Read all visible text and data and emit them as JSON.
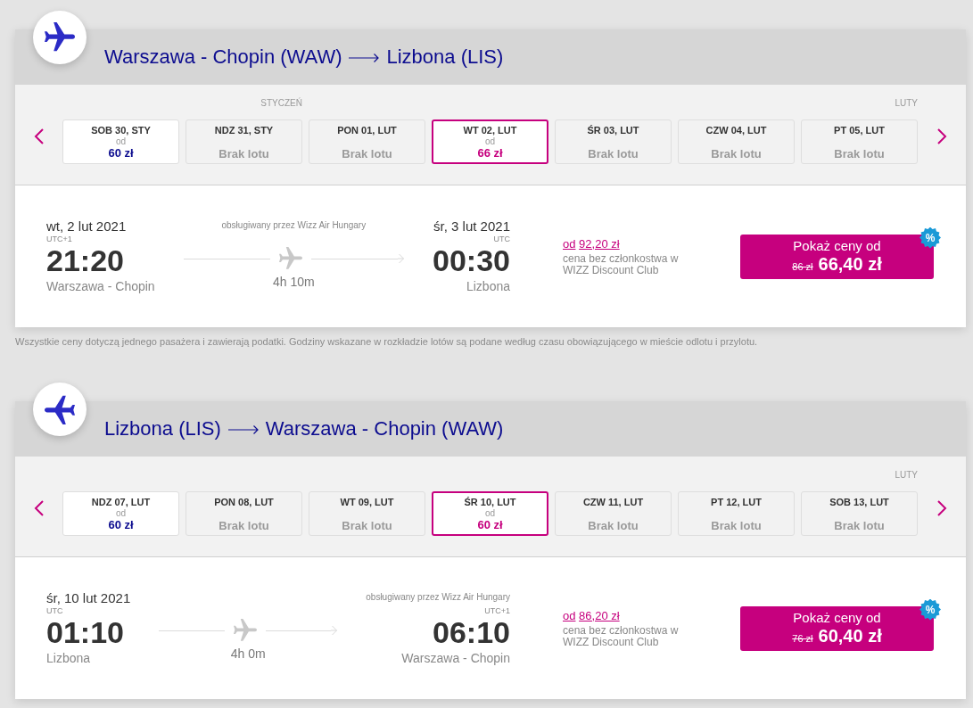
{
  "routes": [
    {
      "kind": "outbound",
      "origin": "Warszawa - Chopin (WAW)",
      "destination": "Lizbona (LIS)",
      "months": [
        {
          "label": "STYCZEŃ",
          "days": [
            {
              "label": "SOB 30, STY",
              "kind": "available",
              "from": "od",
              "price": "60 zł",
              "selected": false
            },
            {
              "label": "NDZ 31, STY",
              "kind": "unavailable",
              "status": "Brak lotu",
              "selected": false
            }
          ]
        },
        {
          "label": "LUTY",
          "days": [
            {
              "label": "PON 01, LUT",
              "kind": "unavailable",
              "status": "Brak lotu",
              "selected": false
            },
            {
              "label": "WT 02, LUT",
              "kind": "available",
              "from": "od",
              "price": "66 zł",
              "selected": true
            },
            {
              "label": "ŚR 03, LUT",
              "kind": "unavailable",
              "status": "Brak lotu",
              "selected": false
            },
            {
              "label": "CZW 04, LUT",
              "kind": "unavailable",
              "status": "Brak lotu",
              "selected": false
            },
            {
              "label": "PT 05, LUT",
              "kind": "unavailable",
              "status": "Brak lotu",
              "selected": false
            }
          ]
        }
      ],
      "flight": {
        "departure": {
          "date": "wt, 2 lut 2021",
          "timezone": "UTC+1",
          "time": "21:20",
          "airport": "Warszawa - Chopin"
        },
        "operator": "obsługiwany przez Wizz Air Hungary",
        "duration": "4h 10m",
        "arrival": {
          "date": "śr, 3 lut 2021",
          "timezone": "UTC",
          "time": "00:30",
          "airport": "Lizbona"
        },
        "regular_price": {
          "prefix": "od",
          "amount": "92,20 zł"
        },
        "regular_price_note": "cena bez członkostwa w WIZZ Discount Club",
        "button": {
          "label": "Pokaż ceny od",
          "old_price": "86 zł",
          "price": "66,40 zł",
          "badge": "%"
        }
      },
      "note": "Wszystkie ceny dotyczą jednego pasażera i zawierają podatki. Godziny wskazane w rozkładzie lotów są podane według czasu obowiązującego w mieście odlotu i przylotu."
    },
    {
      "kind": "return",
      "origin": "Lizbona (LIS)",
      "destination": "Warszawa - Chopin (WAW)",
      "months": [
        {
          "label": "LUTY",
          "days": [
            {
              "label": "NDZ 07, LUT",
              "kind": "available",
              "from": "od",
              "price": "60 zł",
              "selected": false
            },
            {
              "label": "PON 08, LUT",
              "kind": "unavailable",
              "status": "Brak lotu",
              "selected": false
            },
            {
              "label": "WT 09, LUT",
              "kind": "unavailable",
              "status": "Brak lotu",
              "selected": false
            },
            {
              "label": "ŚR 10, LUT",
              "kind": "available",
              "from": "od",
              "price": "60 zł",
              "selected": true
            },
            {
              "label": "CZW 11, LUT",
              "kind": "unavailable",
              "status": "Brak lotu",
              "selected": false
            },
            {
              "label": "PT 12, LUT",
              "kind": "unavailable",
              "status": "Brak lotu",
              "selected": false
            },
            {
              "label": "SOB 13, LUT",
              "kind": "unavailable",
              "status": "Brak lotu",
              "selected": false
            }
          ]
        }
      ],
      "flight": {
        "departure": {
          "date": "śr, 10 lut 2021",
          "timezone": "UTC",
          "time": "01:10",
          "airport": "Lizbona"
        },
        "operator": "obsługiwany przez Wizz Air Hungary",
        "duration": "4h 0m",
        "arrival": {
          "timezone": "UTC+1",
          "time": "06:10",
          "airport": "Warszawa - Chopin"
        },
        "regular_price": {
          "prefix": "od",
          "amount": "86,20 zł"
        },
        "regular_price_note": "cena bez członkostwa w WIZZ Discount Club",
        "button": {
          "label": "Pokaż ceny od",
          "old_price": "76 zł",
          "price": "60,40 zł",
          "badge": "%"
        }
      }
    }
  ]
}
